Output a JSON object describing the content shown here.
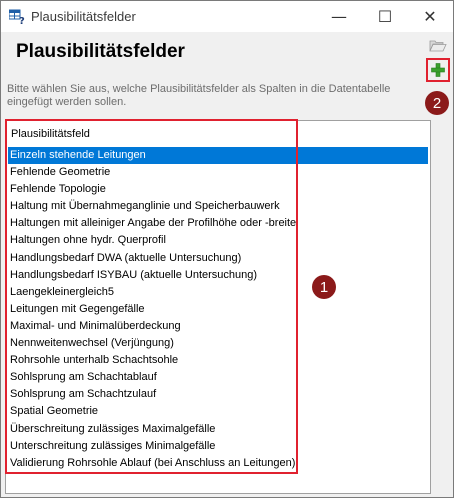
{
  "window": {
    "title": "Plausibilitätsfelder",
    "minimize_glyph": "—",
    "maximize_glyph": "☐",
    "close_glyph": "✕"
  },
  "dialog": {
    "heading": "Plausibilitätsfelder",
    "description": "Bitte wählen Sie aus, welche Plausibilitätsfelder als Spalten in die Datentabelle eingefügt werden sollen."
  },
  "list": {
    "header": "Plausibilitätsfeld",
    "items": [
      "Einzeln stehende Leitungen",
      "Fehlende Geometrie",
      "Fehlende Topologie",
      "Haltung mit Übernahmeganglinie und Speicherbauwerk",
      "Haltungen mit alleiniger Angabe der Profilhöhe oder -breite",
      "Haltungen ohne hydr. Querprofil",
      "Handlungsbedarf DWA (aktuelle Untersuchung)",
      "Handlungsbedarf ISYBAU (aktuelle Untersuchung)",
      "Laengekleinergleich5",
      "Leitungen mit Gegengefälle",
      "Maximal- und Minimalüberdeckung",
      "Nennweitenwechsel (Verjüngung)",
      "Rohrsohle unterhalb Schachtsohle",
      "Sohlsprung am Schachtablauf",
      "Sohlsprung am Schachtzulauf",
      "Spatial Geometrie",
      "Überschreitung zulässiges Maximalgefälle",
      "Unterschreitung zulässiges Minimalgefälle",
      "Validierung Rohrsohle Ablauf (bei Anschluss an Leitungen)"
    ],
    "selected_index": 0
  },
  "annotations": {
    "badge_1": "1",
    "badge_2": "2"
  },
  "icons": {
    "open": "folder-open-icon",
    "add": "green-plus-icon"
  },
  "colors": {
    "selection": "#0078d7",
    "annotation_red": "#e0212f",
    "badge": "#8b1a1a",
    "add_green": "#3aa12d"
  }
}
